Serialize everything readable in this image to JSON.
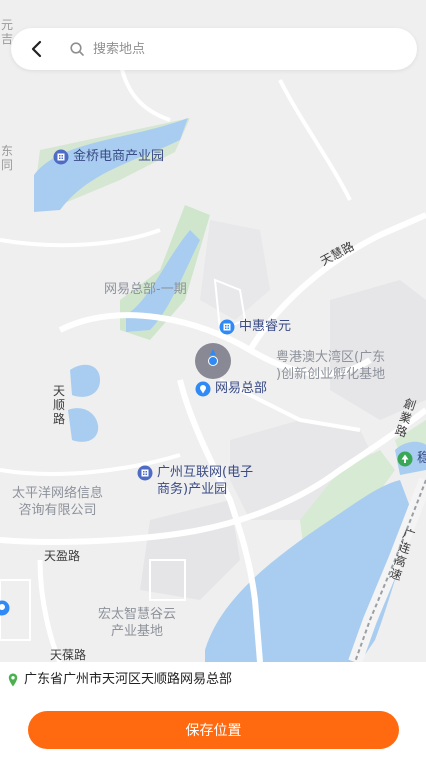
{
  "search": {
    "placeholder": "搜索地点"
  },
  "map": {
    "pois": [
      {
        "name": "jinqiao",
        "label": "金桥电商产业园"
      },
      {
        "name": "zhonghui",
        "label": "中惠睿元"
      },
      {
        "name": "wangyi",
        "label": "网易总部"
      },
      {
        "name": "hulianwang",
        "label_line1": "广州互联网(电子",
        "label_line2": "商务)产业园"
      },
      {
        "name": "wen",
        "label": "稳"
      }
    ],
    "areas": {
      "wangyi_phase1": "网易总部-一期",
      "gba_line1": "粤港澳大湾区(广东",
      "gba_line2": ")创新创业孵化基地",
      "taipingyang_line1": "太平洋网络信息",
      "taipingyang_line2": "咨询有限公司",
      "hongtai_line1": "宏太智慧谷云",
      "hongtai_line2": "产业基地"
    },
    "roads": {
      "tianhui": "天慧路",
      "tianshun": "天顺路",
      "tianying": "天盈路",
      "tianxiao": "天葆路",
      "guanglian": "广连高速",
      "chuangye": "創業路",
      "edge_top": "元吉",
      "edge_left": "东同"
    }
  },
  "address": {
    "text": "广东省广州市天河区天顺路网易总部"
  },
  "save_button": {
    "label": "保存位置"
  },
  "colors": {
    "accent": "#ff6a10",
    "poi_text": "#3a4b86",
    "water": "#a9cdf0",
    "park": "#cfe6cc",
    "location_pin": "#4caf50"
  },
  "icons": {
    "back": "chevron-left-icon",
    "search": "search-icon",
    "poi": "building-pin-icon",
    "address": "location-pin-icon"
  }
}
